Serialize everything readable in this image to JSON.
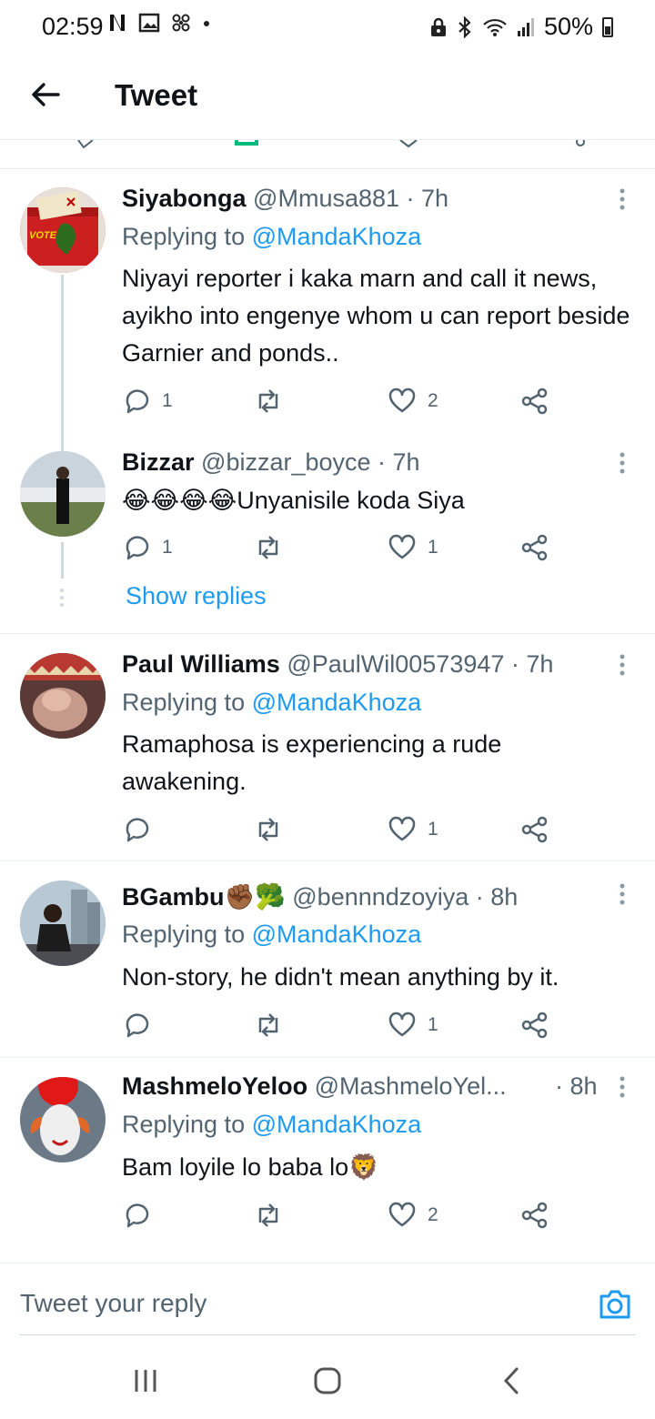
{
  "status_bar": {
    "time": "02:59",
    "left_icons": [
      "netflix-icon",
      "image-icon",
      "fan-icon",
      "dot-icon"
    ],
    "battery_percent": "50%",
    "right_icons": [
      "lock-icon",
      "bluetooth-icon",
      "wifi-icon",
      "signal-icon",
      "battery-icon"
    ]
  },
  "header": {
    "title": "Tweet",
    "back_icon": "arrow-left-icon"
  },
  "tweets": [
    {
      "name": "Siyabonga",
      "handle": "@Mmusa881 · 7h",
      "reply_prefix": "Replying to",
      "reply_to": "@MandaKhoza",
      "text": "Niyayi reporter i kaka marn and call it news, ayikho into engenye whom u can report beside Garnier and ponds..",
      "reply_count": "1",
      "retweet_count": "",
      "like_count": "2",
      "avatar_text": "VOTE"
    },
    {
      "name": "Bizzar",
      "handle": "@bizzar_boyce · 7h",
      "text": "😂😂😂😂Unyanisile koda Siya",
      "reply_count": "1",
      "retweet_count": "",
      "like_count": "1"
    },
    {
      "name": "Paul Williams",
      "handle": "@PaulWil00573947 · 7h",
      "reply_prefix": "Replying to",
      "reply_to": "@MandaKhoza",
      "text": "Ramaphosa is experiencing a rude awakening.",
      "reply_count": "",
      "retweet_count": "",
      "like_count": "1"
    },
    {
      "name": "BGambu✊🏾🥦",
      "handle": "@bennndzoyiya · 8h",
      "reply_prefix": "Replying to",
      "reply_to": "@MandaKhoza",
      "text": "Non-story, he didn't mean anything by it.",
      "reply_count": "",
      "retweet_count": "",
      "like_count": "1"
    },
    {
      "name": "MashmeloYeloo",
      "handle": "@MashmeloYel...",
      "time": "· 8h",
      "reply_prefix": "Replying to",
      "reply_to": "@MandaKhoza",
      "text": "Bam loyile lo baba lo🦁",
      "reply_count": "",
      "retweet_count": "",
      "like_count": "2"
    }
  ],
  "show_replies_label": "Show replies",
  "reply_bar": {
    "placeholder": "Tweet your reply",
    "camera_icon": "camera-icon"
  },
  "nav_bar": {
    "icons": [
      "recent-apps-icon",
      "home-icon",
      "back-icon"
    ]
  },
  "colors": {
    "accent": "#1d9bf0",
    "text_primary": "#0f1419",
    "text_secondary": "#536471",
    "divider": "#e6ecf0"
  }
}
